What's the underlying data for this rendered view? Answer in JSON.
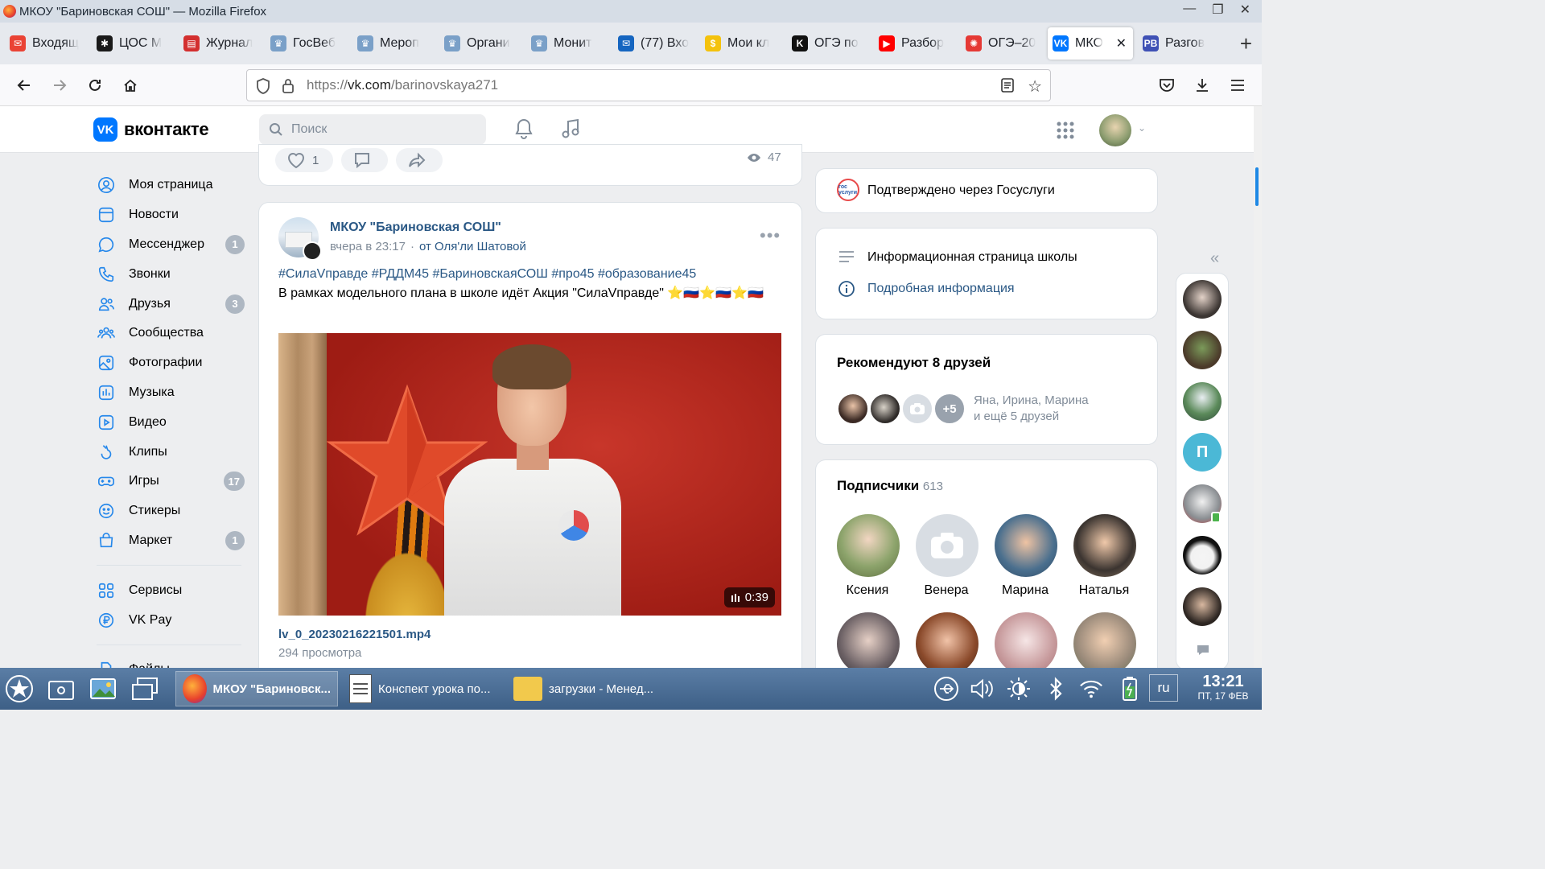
{
  "window": {
    "title": "МКОУ \"Бариновская СОШ\" — Mozilla Firefox",
    "controls": [
      "—",
      "❐",
      "✕"
    ]
  },
  "tabs": [
    {
      "label": "Входящ",
      "color": "#ea4335",
      "glyph": "✉"
    },
    {
      "label": "ЦОС М",
      "color": "#1a1a1a",
      "glyph": "✱"
    },
    {
      "label": "Журнал",
      "color": "#d32f2f",
      "glyph": "▤"
    },
    {
      "label": "ГосВеб",
      "color": "#7aa0c8",
      "glyph": "♛"
    },
    {
      "label": "Мероп",
      "color": "#7aa0c8",
      "glyph": "♛"
    },
    {
      "label": "Органи",
      "color": "#7aa0c8",
      "glyph": "♛"
    },
    {
      "label": "Монит",
      "color": "#7aa0c8",
      "glyph": "♛"
    },
    {
      "label": "(77) Вхо",
      "color": "#1565c0",
      "glyph": "✉"
    },
    {
      "label": "Мои кл",
      "color": "#f4c20d",
      "glyph": "$"
    },
    {
      "label": "ОГЭ по",
      "color": "#111111",
      "glyph": "K"
    },
    {
      "label": "Разбор",
      "color": "#ff0000",
      "glyph": "▶"
    },
    {
      "label": "ОГЭ–20",
      "color": "#e53935",
      "glyph": "✺"
    },
    {
      "label": "МКО",
      "color": "#0077ff",
      "glyph": "VK",
      "active": true
    },
    {
      "label": "Разгов",
      "color": "#3f51b5",
      "glyph": "PB"
    }
  ],
  "nav": {
    "url_prefix": "https://",
    "url_host": "vk.com",
    "url_path": "/barinovskaya271"
  },
  "vk": {
    "brand": "вконтакте",
    "search_placeholder": "Поиск",
    "menu": [
      {
        "label": "Моя страница",
        "icon": "user-circle-icon"
      },
      {
        "label": "Новости",
        "icon": "news-icon"
      },
      {
        "label": "Мессенджер",
        "icon": "message-icon",
        "badge": "1"
      },
      {
        "label": "Звонки",
        "icon": "phone-icon"
      },
      {
        "label": "Друзья",
        "icon": "friends-icon",
        "badge": "3"
      },
      {
        "label": "Сообщества",
        "icon": "communities-icon"
      },
      {
        "label": "Фотографии",
        "icon": "photo-icon"
      },
      {
        "label": "Музыка",
        "icon": "music-icon"
      },
      {
        "label": "Видео",
        "icon": "video-icon"
      },
      {
        "label": "Клипы",
        "icon": "clips-icon"
      },
      {
        "label": "Игры",
        "icon": "games-icon",
        "badge": "17"
      },
      {
        "label": "Стикеры",
        "icon": "stickers-icon"
      },
      {
        "label": "Маркет",
        "icon": "market-icon",
        "badge": "1"
      }
    ],
    "menu2": [
      {
        "label": "Сервисы",
        "icon": "services-icon"
      },
      {
        "label": "VK Pay",
        "icon": "vkpay-icon"
      }
    ],
    "menu3": [
      {
        "label": "Файлы",
        "icon": "file-icon"
      }
    ],
    "prev_post": {
      "likes": "1",
      "views": "47"
    },
    "post": {
      "author": "МКОУ \"Бариновская СОШ\"",
      "time": "вчера в 23:17",
      "dot": "·",
      "from": "от Оля'ли Шатовой",
      "tags": "#СилаVправде #РДДМ45 #БариновскаяСОШ #про45 #образование45",
      "text": "В рамках модельного плана в школе идёт Акция \"СилаVправде\" ⭐🇷🇺⭐🇷🇺⭐🇷🇺",
      "video_duration": "0:39",
      "file_name": "lv_0_20230216221501.mp4",
      "file_views": "294 просмотра",
      "more": "•••"
    },
    "right": {
      "gos_badge": "гос услуги",
      "gosuslugi": "Подтверждено через Госуслуги",
      "info_title": "Информационная страница школы",
      "info_link": "Подробная информация",
      "recommend_title": "Рекомендуют 8 друзей",
      "recommend_plus": "+5",
      "recommend_names_1": "Яна, Ирина, Марина",
      "recommend_names_2": "и ещё 5 друзей",
      "subs_title": "Подписчики",
      "subs_count": "613",
      "subs": [
        "Ксения",
        "Венера",
        "Марина",
        "Наталья"
      ],
      "strip_letter": "П"
    }
  },
  "taskbar": {
    "windows": [
      {
        "label": "МКОУ \"Бариновск...",
        "active": true
      },
      {
        "label": "Конспект урока по..."
      },
      {
        "label": "загрузки - Менед..."
      }
    ],
    "lang": "ru",
    "time": "13:21",
    "date": "ПТ, 17 ФЕВ"
  }
}
